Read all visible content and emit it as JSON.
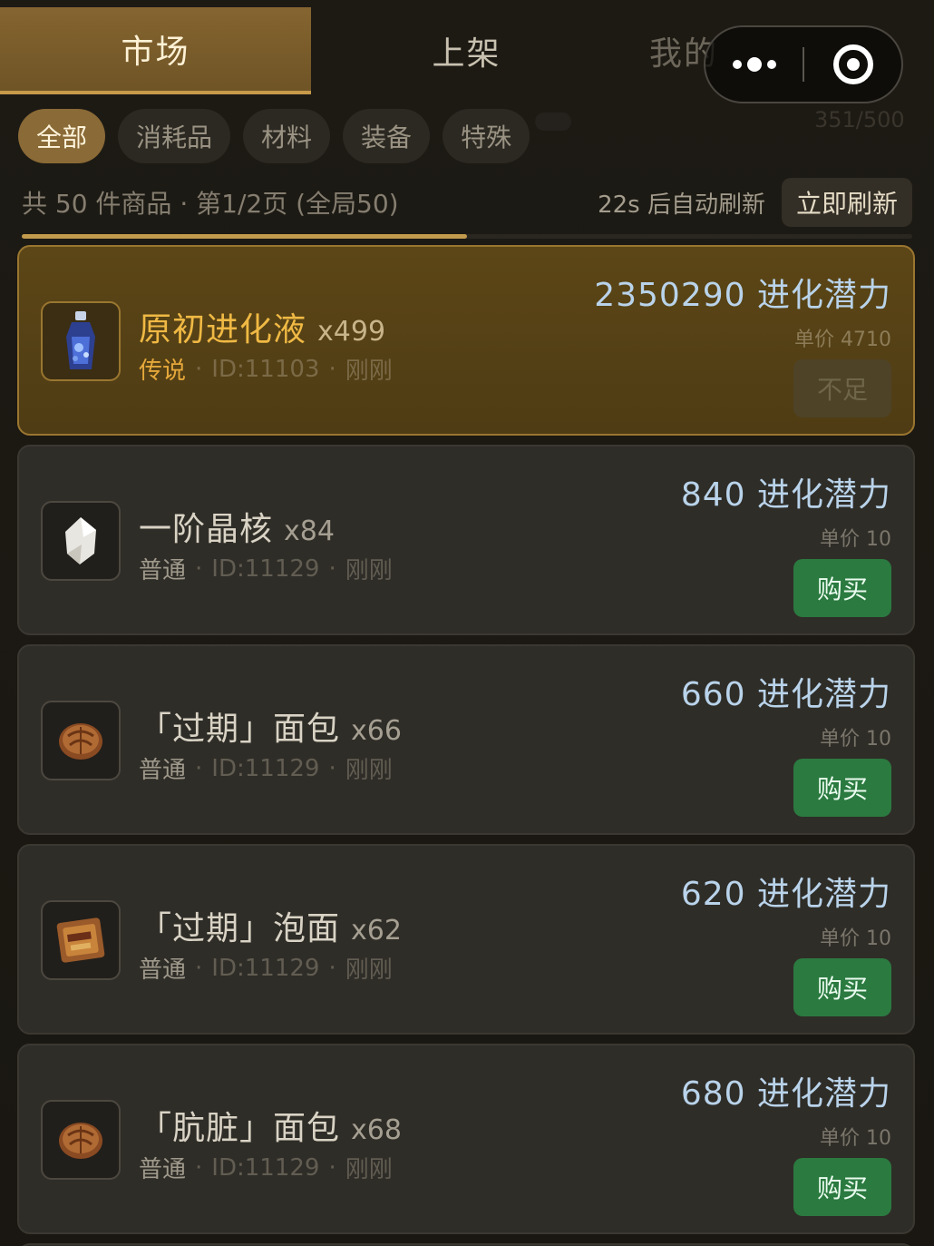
{
  "tabs": {
    "market": "市场",
    "listing": "上架",
    "mine": "我的"
  },
  "capsule": {
    "more_icon": "more-dots-icon",
    "close_icon": "target-close-icon"
  },
  "capacity": "351/500",
  "filters": [
    "全部",
    "消耗品",
    "材料",
    "装备",
    "特殊"
  ],
  "info": {
    "count_text": "共 50 件商品 · 第1/2页 (全局50)",
    "timer_text": "22s 后自动刷新",
    "refresh_label": "立即刷新",
    "page_progress": 0.5
  },
  "items": [
    {
      "name": "原初进化液",
      "qty": "x499",
      "rarity": "传说",
      "id": "ID:11103",
      "time": "刚刚",
      "price": "2350290 进化潜力",
      "unit_price": "单价 4710",
      "action": "不足",
      "icon": "potion-bottle-icon"
    },
    {
      "name": "一阶晶核",
      "qty": "x84",
      "rarity": "普通",
      "id": "ID:11129",
      "time": "刚刚",
      "price": "840 进化潜力",
      "unit_price": "单价 10",
      "action": "购买",
      "icon": "crystal-core-icon"
    },
    {
      "name": "「过期」面包",
      "qty": "x66",
      "rarity": "普通",
      "id": "ID:11129",
      "time": "刚刚",
      "price": "660 进化潜力",
      "unit_price": "单价 10",
      "action": "购买",
      "icon": "bread-icon"
    },
    {
      "name": "「过期」泡面",
      "qty": "x62",
      "rarity": "普通",
      "id": "ID:11129",
      "time": "刚刚",
      "price": "620 进化潜力",
      "unit_price": "单价 10",
      "action": "购买",
      "icon": "instant-noodles-icon"
    },
    {
      "name": "「肮脏」面包",
      "qty": "x68",
      "rarity": "普通",
      "id": "ID:11129",
      "time": "刚刚",
      "price": "680 进化潜力",
      "unit_price": "单价 10",
      "action": "购买",
      "icon": "bread-icon"
    }
  ],
  "colors": {
    "accent": "#8a6a36",
    "legend_gold": "#f0b944",
    "buy_green": "#2b7a40",
    "price_blue": "#b9d3ea"
  }
}
